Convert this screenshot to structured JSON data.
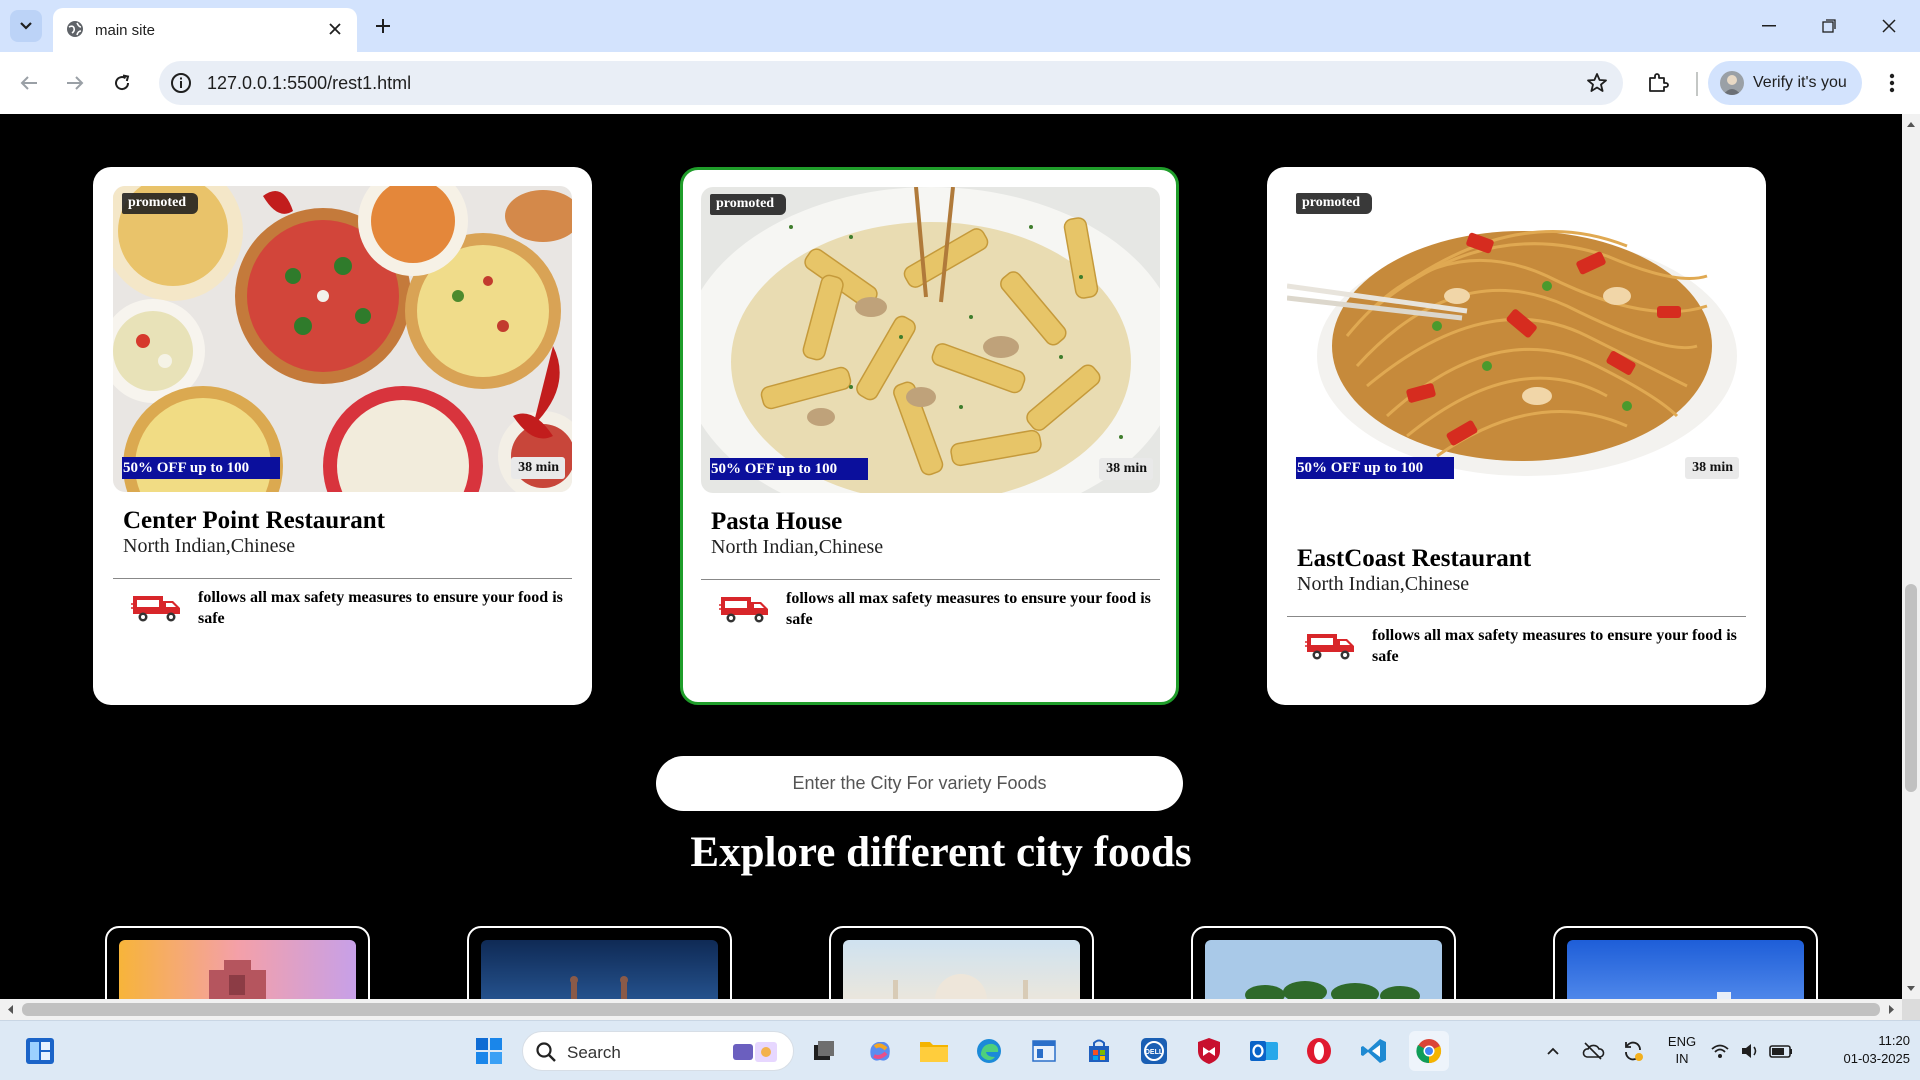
{
  "browser": {
    "tab_title": "main site",
    "url": "127.0.0.1:5500/rest1.html",
    "profile_label": "Verify it's you"
  },
  "restaurants": [
    {
      "name": "Center Point Restaurant",
      "cuisine": "North Indian,Chinese",
      "badge": "promoted",
      "offer": "50% OFF up to 100",
      "time": "38 min",
      "safety": "follows all max safety measures to ensure your food is safe",
      "image_icon": "pizza-spread-image"
    },
    {
      "name": "Pasta House",
      "cuisine": "North Indian,Chinese",
      "badge": "promoted",
      "offer": "50% OFF up to 100",
      "time": "38 min",
      "safety": "follows all max safety measures to ensure your food is safe",
      "image_icon": "penne-pasta-image"
    },
    {
      "name": "EastCoast Restaurant",
      "cuisine": "North Indian,Chinese",
      "badge": "promoted",
      "offer": "50% OFF up to 100",
      "time": "38 min",
      "safety": "follows all max safety measures to ensure your food is safe",
      "image_icon": "noodles-image"
    }
  ],
  "city_search": {
    "placeholder": "Enter the City For variety Foods"
  },
  "explore_title": "Explore different city foods",
  "taskbar": {
    "search_label": "Search",
    "lang_line1": "ENG",
    "lang_line2": "IN",
    "time": "11:20",
    "date": "01-03-2025"
  },
  "colors": {
    "offer_bg": "#0b0f9c",
    "active_border": "#1f9d2a",
    "page_bg": "#000000"
  }
}
